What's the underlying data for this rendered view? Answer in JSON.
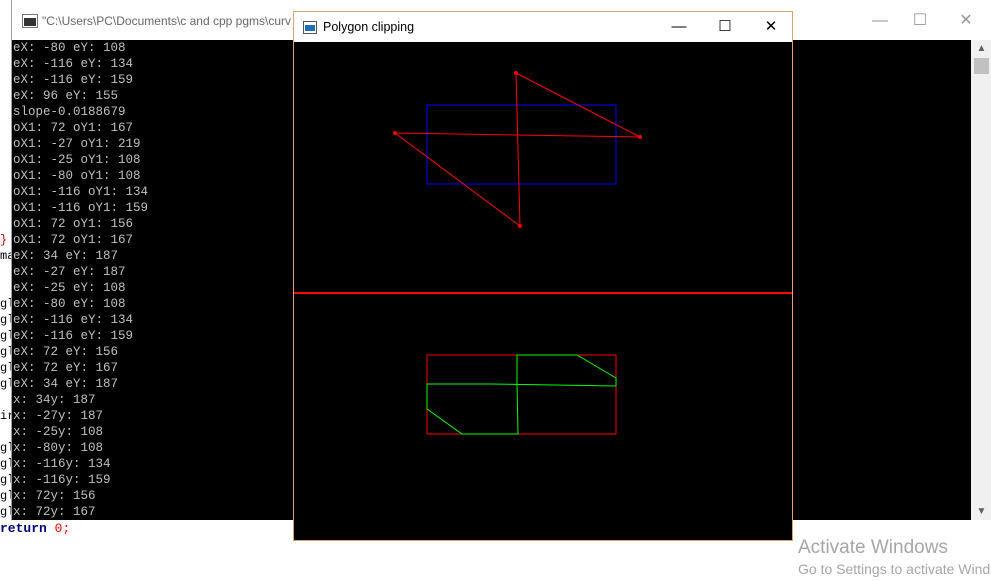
{
  "console": {
    "title": "\"C:\\Users\\PC\\Documents\\c and cpp pgms\\curv",
    "controls": {
      "minimize": "—",
      "maximize": "☐",
      "close": "✕"
    },
    "lines": [
      "eX: -80 eY: 108",
      "eX: -116 eY: 134",
      "eX: -116 eY: 159",
      "eX: 96 eY: 155",
      "slope-0.0188679",
      "oX1: 72 oY1: 167",
      "oX1: -27 oY1: 219",
      "oX1: -25 oY1: 108",
      "oX1: -80 oY1: 108",
      "oX1: -116 oY1: 134",
      "oX1: -116 oY1: 159",
      "oX1: 72 oY1: 156",
      "oX1: 72 oY1: 167",
      "eX: 34 eY: 187",
      "eX: -27 eY: 187",
      "eX: -25 eY: 108",
      "eX: -80 eY: 108",
      "eX: -116 eY: 134",
      "eX: -116 eY: 159",
      "eX: 72 eY: 156",
      "eX: 72 eY: 167",
      "eX: 34 eY: 187",
      "x: 34y: 187",
      "x: -27y: 187",
      "x: -25y: 108",
      "x: -80y: 108",
      "x: -116y: 134",
      "x: -116y: 159",
      "x: 72y: 156",
      "x: 72y: 167"
    ],
    "scroll": {
      "up": "▲",
      "down": "▼"
    }
  },
  "editor": {
    "gutter": [
      "",
      "",
      "",
      "",
      "",
      "",
      "",
      "",
      "",
      "",
      "",
      "",
      "}",
      "ma",
      "",
      "",
      "gl",
      "gl",
      "gl",
      "gl",
      "gl",
      "gl",
      "",
      "ir",
      "",
      "gl",
      "gl",
      "gl",
      "gl",
      "gl"
    ],
    "bottom_keyword": "return",
    "bottom_value": "0",
    "bottom_semicolon": ";"
  },
  "graphics": {
    "title": "Polygon clipping",
    "controls": {
      "minimize": "—",
      "maximize": "☐",
      "close": "✕"
    },
    "colors": {
      "background": "#000000",
      "polygon": "#ff0000",
      "clip_window_top": "#0000ff",
      "divider": "#ff0000",
      "clip_window_bottom": "#ff0000",
      "clipped": "#00ff00"
    }
  },
  "watermark": {
    "title": "Activate Windows",
    "subtitle": "Go to Settings to activate Windows."
  }
}
